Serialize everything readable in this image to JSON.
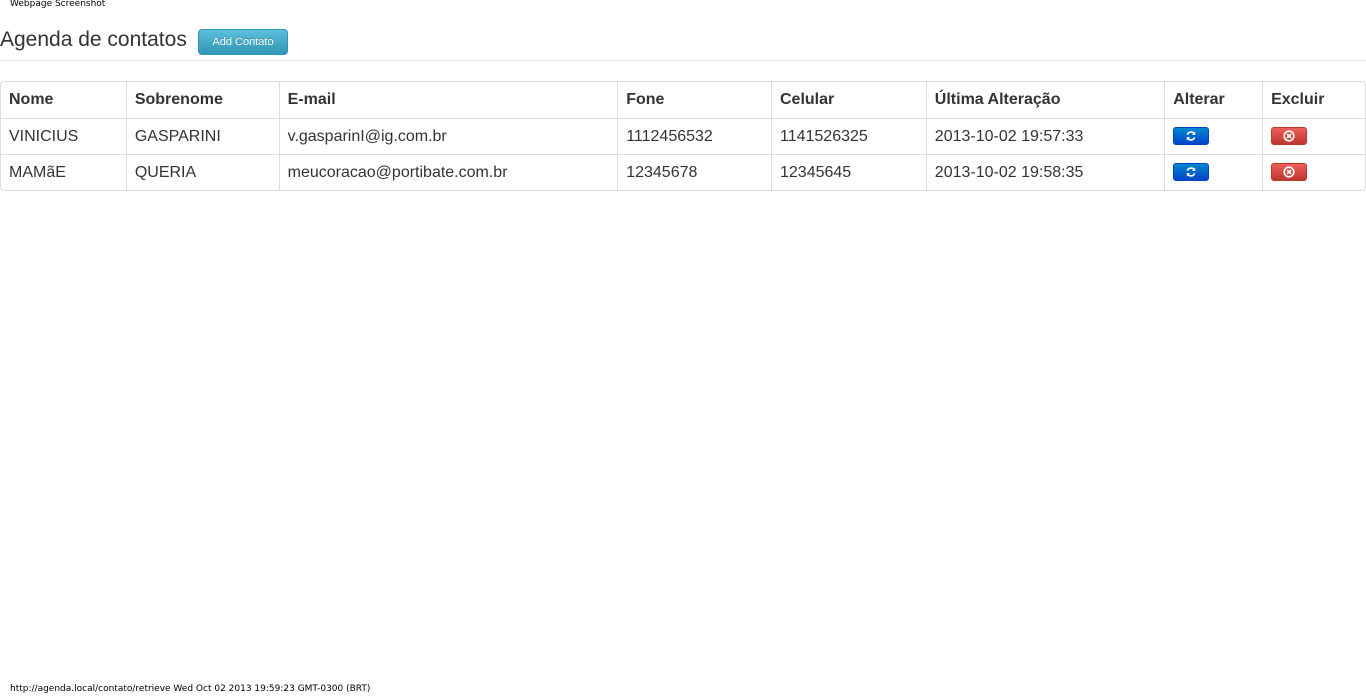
{
  "capture": {
    "title": "Webpage Screenshot",
    "footer": "http://agenda.local/contato/retrieve Wed Oct 02 2013 19:59:23 GMT-0300 (BRT)"
  },
  "header": {
    "title": "Agenda de contatos",
    "add_button_label": "Add Contato"
  },
  "table": {
    "columns": [
      "Nome",
      "Sobrenome",
      "E-mail",
      "Fone",
      "Celular",
      "Última Alteração",
      "Alterar",
      "Excluir"
    ],
    "rows": [
      {
        "nome": "VINICIUS",
        "sobrenome": "GASPARINI",
        "email": "v.gasparinI@ig.com.br",
        "fone": "1112456532",
        "celular": "1141526325",
        "alteracao": "2013-10-02 19:57:33",
        "alterar_icon": "refresh-icon",
        "excluir_icon": "remove-circle-icon"
      },
      {
        "nome": "MAMãE",
        "sobrenome": "QUERIA",
        "email": "meucoracao@portibate.com.br",
        "fone": "12345678",
        "celular": "12345645",
        "alteracao": "2013-10-02 19:58:35",
        "alterar_icon": "refresh-icon",
        "excluir_icon": "remove-circle-icon"
      }
    ]
  },
  "colors": {
    "info_button": "#49afcd",
    "primary_button": "#0055cc",
    "danger_button": "#da4f49",
    "border": "#dddddd"
  }
}
